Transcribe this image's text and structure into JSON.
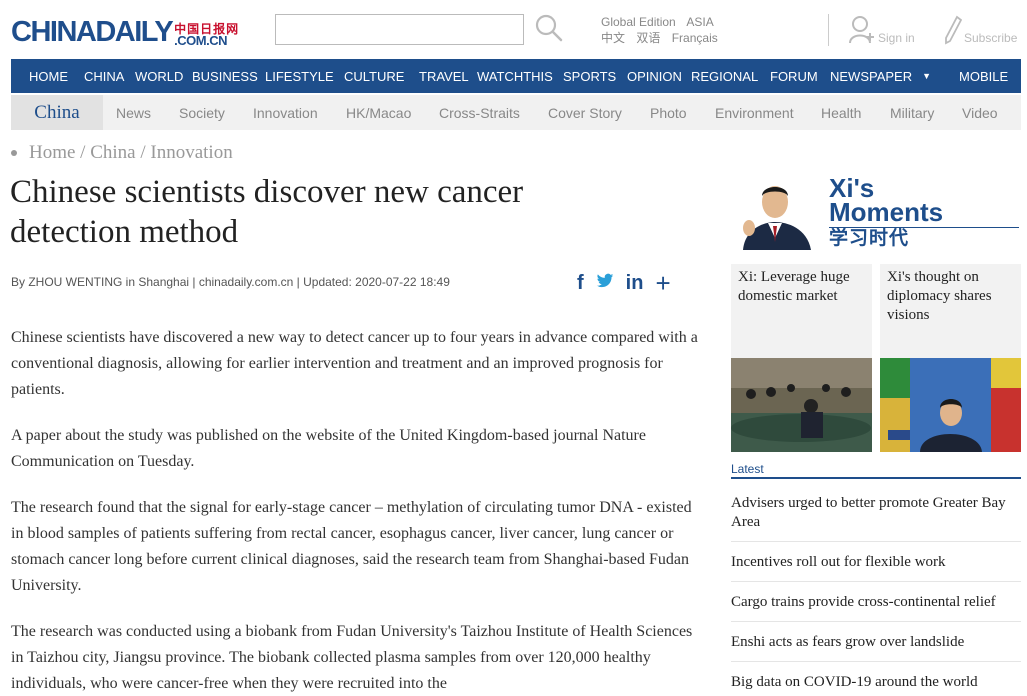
{
  "header": {
    "logo_main": "CHINADAILY",
    "logo_cn": "中国日报网",
    "logo_com": ".COM.CN",
    "search_placeholder": "",
    "editions_row1": [
      "Global Edition",
      "ASIA"
    ],
    "editions_row2": [
      "中文",
      "双语",
      "Français"
    ],
    "signin_label": "Sign in",
    "subscribe_label": "Subscribe"
  },
  "mainnav": {
    "items": [
      "HOME",
      "CHINA",
      "WORLD",
      "BUSINESS",
      "LIFESTYLE",
      "CULTURE",
      "TRAVEL",
      "WATCHTHIS",
      "SPORTS",
      "OPINION",
      "REGIONAL",
      "FORUM",
      "NEWSPAPER",
      "MOBILE"
    ]
  },
  "subnav": {
    "current": "China",
    "items": [
      "News",
      "Society",
      "Innovation",
      "HK/Macao",
      "Cross-Straits",
      "Cover Story",
      "Photo",
      "Environment",
      "Health",
      "Military",
      "Video"
    ]
  },
  "article": {
    "breadcrumb": "Home / China / Innovation",
    "title": "Chinese scientists discover new cancer detection method",
    "byline": "By ZHOU WENTING in Shanghai | chinadaily.com.cn | Updated: 2020-07-22 18:49",
    "paragraphs": [
      "Chinese scientists have discovered a new way to detect cancer up to four years in advance compared with a conventional diagnosis, allowing for earlier intervention and treatment and an improved prognosis for patients.",
      "A paper about the study was published on the website of the United Kingdom-based journal Nature Communication on Tuesday.",
      "The research found that the signal for early-stage cancer – methylation of circulating tumor DNA - existed in blood samples of patients suffering from rectal cancer, esophagus cancer, liver cancer, lung cancer or stomach cancer long before current clinical diagnoses, said the research team from Shanghai-based Fudan University.",
      "The research was conducted using a biobank from Fudan University's Taizhou Institute of Health Sciences in Taizhou city, Jiangsu province. The biobank collected plasma samples from over 120,000 healthy individuals, who were cancer-free when they were recruited into the"
    ]
  },
  "share": {
    "facebook": "f",
    "twitter": "t",
    "linkedin": "in",
    "more": "+"
  },
  "sidebar": {
    "xi_title_1": "Xi's",
    "xi_title_2": "Moments",
    "xi_subtitle": "学习时代",
    "cards": [
      {
        "caption": "Xi: Leverage huge domestic market"
      },
      {
        "caption": "Xi's thought on diplomacy shares visions"
      }
    ],
    "latest_label": "Latest",
    "latest": [
      "Advisers urged to better promote Greater Bay Area",
      "Incentives roll out for flexible work",
      "Cargo trains provide cross-continental relief",
      "Enshi acts as fears grow over landslide",
      "Big data on COVID-19 around the world"
    ]
  }
}
